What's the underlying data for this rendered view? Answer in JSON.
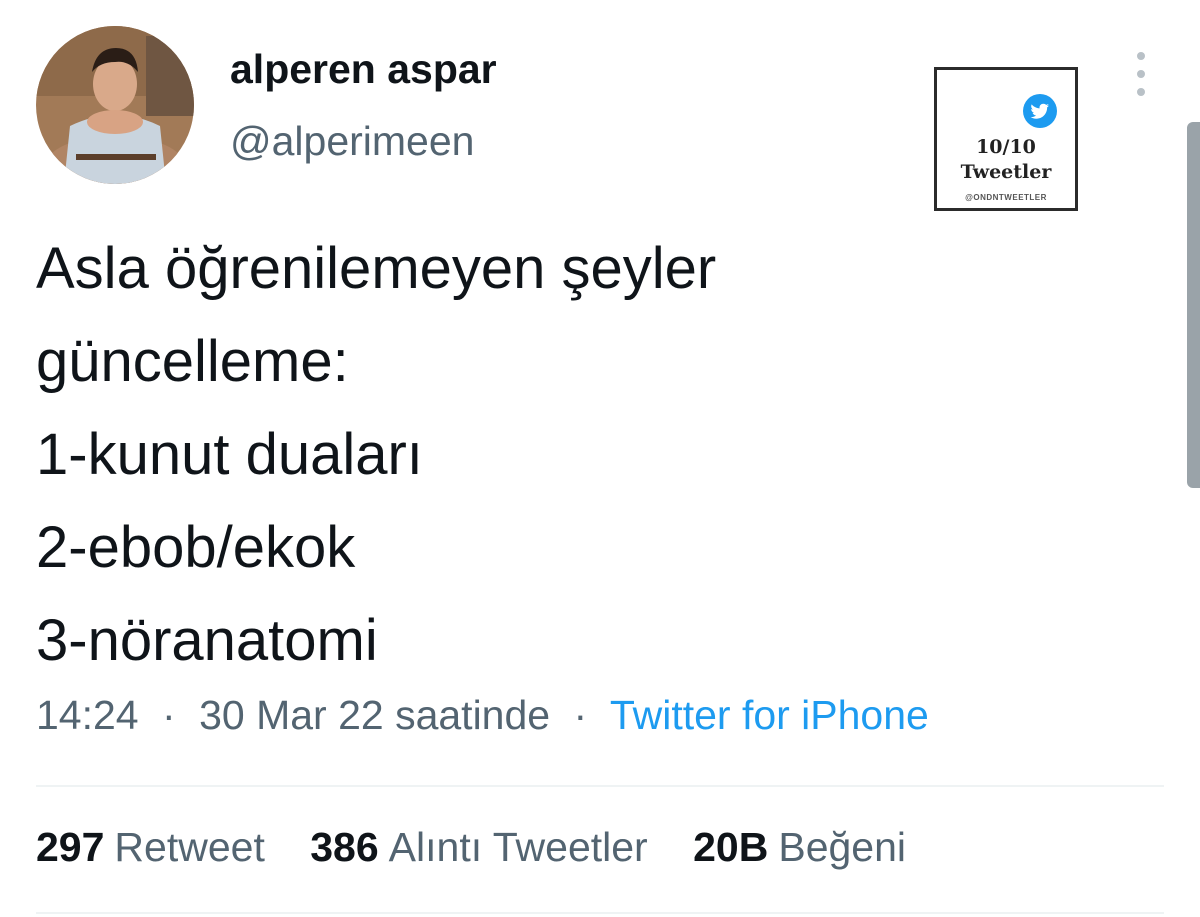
{
  "tweet": {
    "display_name": "alperen aspar",
    "handle": "@alperimeen",
    "lines": [
      "Asla öğrenilemeyen şeyler",
      "güncelleme:",
      "1-kunut duaları",
      "2-ebob/ekok",
      "3-nöranatomi"
    ],
    "time": "14:24",
    "date": "30 Mar 22 saatinde",
    "separator": "·",
    "source": "Twitter for iPhone"
  },
  "stats": [
    {
      "count": "297",
      "label": "Retweet"
    },
    {
      "count": "386",
      "label": "Alıntı Tweetler"
    },
    {
      "count": "20B",
      "label": "Beğeni"
    }
  ],
  "watermark": {
    "score": "10/10",
    "title": "Tweetler",
    "handle": "@ONDNTWEETLER",
    "icon": "twitter-bird-icon"
  },
  "colors": {
    "primary_text": "#0f1419",
    "secondary_text": "#536471",
    "accent": "#1d9bf0",
    "divider": "#eff3f4"
  }
}
